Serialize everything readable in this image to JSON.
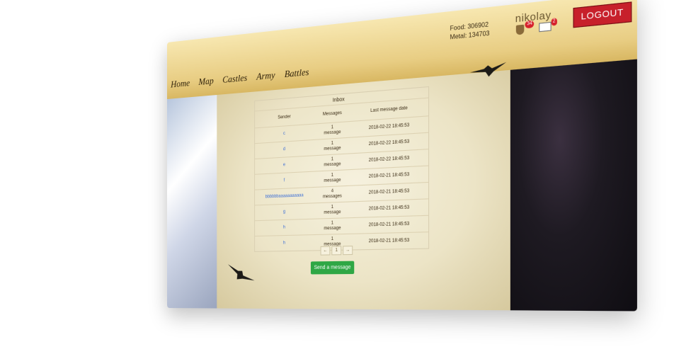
{
  "nav": {
    "items": [
      "Home",
      "Map",
      "Castles",
      "Army",
      "Battles"
    ]
  },
  "resources": {
    "food": "Food: 306902",
    "metal": "Metal: 134703"
  },
  "user": {
    "name": "nikolay",
    "shield_badge": "34",
    "mail_badge": "2",
    "logout": "LOGOUT"
  },
  "inbox": {
    "title": "Inbox",
    "columns": [
      "Sender",
      "Messages",
      "Last message date"
    ],
    "rows": [
      {
        "sender": "c",
        "messages": [
          "1",
          "message"
        ],
        "date": "2018-02-22 18:45:53"
      },
      {
        "sender": "d",
        "messages": [
          "1",
          "message"
        ],
        "date": "2018-02-22 18:45:53"
      },
      {
        "sender": "e",
        "messages": [
          "1",
          "message"
        ],
        "date": "2018-02-22 18:45:53"
      },
      {
        "sender": "f",
        "messages": [
          "1",
          "message"
        ],
        "date": "2018-02-21 18:45:53"
      },
      {
        "sender": "bbbbbbaaaaaaaaaaa",
        "messages": [
          "4",
          "messages"
        ],
        "date": "2018-02-21 18:45:53"
      },
      {
        "sender": "g",
        "messages": [
          "1",
          "message"
        ],
        "date": "2018-02-21 18:45:53"
      },
      {
        "sender": "h",
        "messages": [
          "1",
          "message"
        ],
        "date": "2018-02-21 18:45:53"
      },
      {
        "sender": "h",
        "messages": [
          "1",
          "message"
        ],
        "date": "2018-02-21 18:45:53"
      }
    ],
    "pager": [
      "←",
      "1",
      "→"
    ],
    "send_button": "Send a message"
  },
  "colors": {
    "logout_bg": "#c7202b",
    "send_button_bg": "#2fa745",
    "link": "#3d6fd6"
  }
}
